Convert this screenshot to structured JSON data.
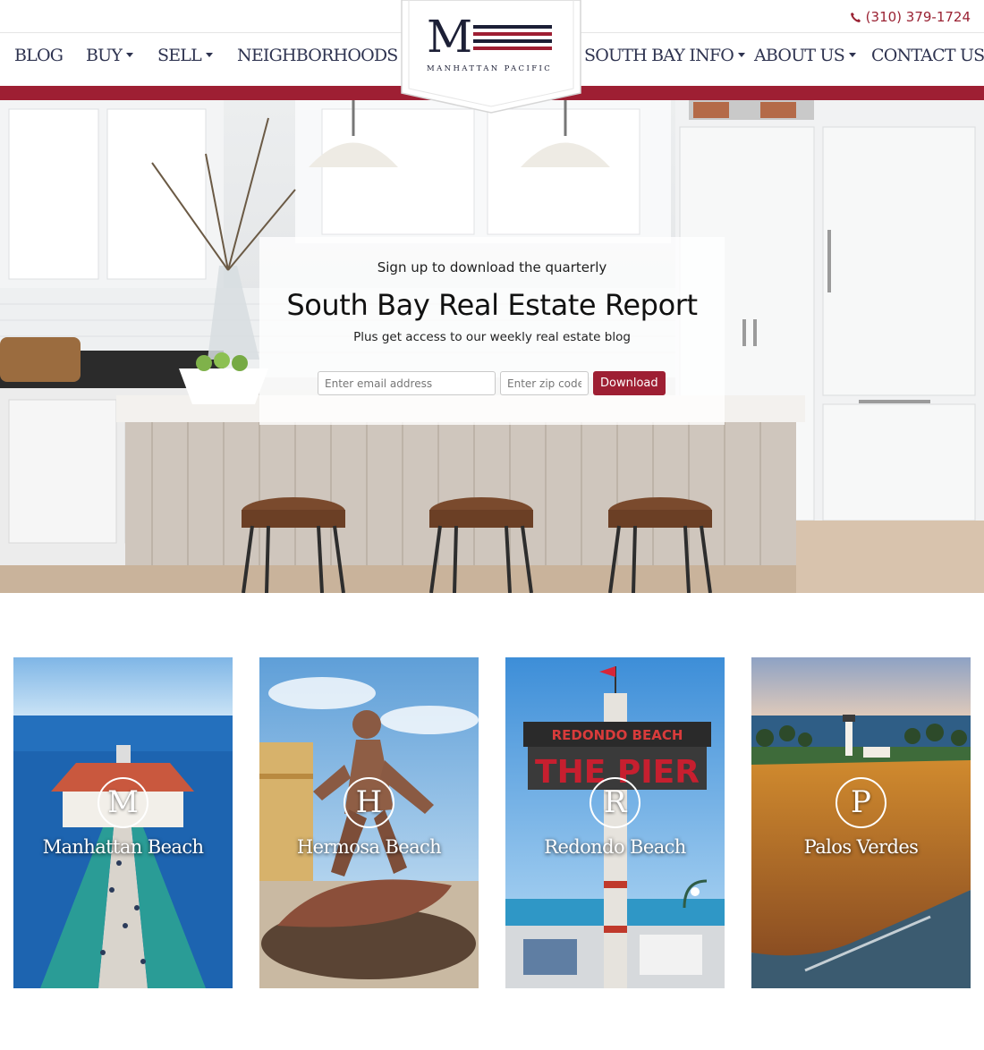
{
  "header": {
    "phone": "(310) 379-1724",
    "logo": {
      "letter": "M",
      "text": "MANHATTAN PACIFIC"
    },
    "nav_left": [
      {
        "label": "BLOG",
        "dropdown": false
      },
      {
        "label": "BUY",
        "dropdown": true
      },
      {
        "label": "SELL",
        "dropdown": true
      },
      {
        "label": "NEIGHBORHOODS",
        "dropdown": true
      }
    ],
    "nav_right": [
      {
        "label": "SOUTH BAY INFO",
        "dropdown": true
      },
      {
        "label": "ABOUT US",
        "dropdown": true
      },
      {
        "label": "CONTACT US",
        "dropdown": false
      }
    ]
  },
  "hero": {
    "pretitle": "Sign up to download the quarterly",
    "title": "South Bay Real Estate Report",
    "subtitle": "Plus get access to our weekly real estate blog",
    "email_placeholder": "Enter email address",
    "zip_placeholder": "Enter zip code",
    "button_label": "Download"
  },
  "neighborhoods": [
    {
      "letter": "M",
      "name": "Manhattan Beach"
    },
    {
      "letter": "H",
      "name": "Hermosa Beach"
    },
    {
      "letter": "R",
      "name": "Redondo Beach"
    },
    {
      "letter": "P",
      "name": "Palos Verdes"
    }
  ],
  "pier_sign": {
    "top": "REDONDO BEACH",
    "main": "THE PIER"
  },
  "colors": {
    "brand_red": "#9e1f33",
    "navy": "#2e3350",
    "logo_navy": "#1c1f36"
  },
  "icons": {
    "phone": "phone-icon",
    "dropdown": "chevron-down-icon"
  }
}
